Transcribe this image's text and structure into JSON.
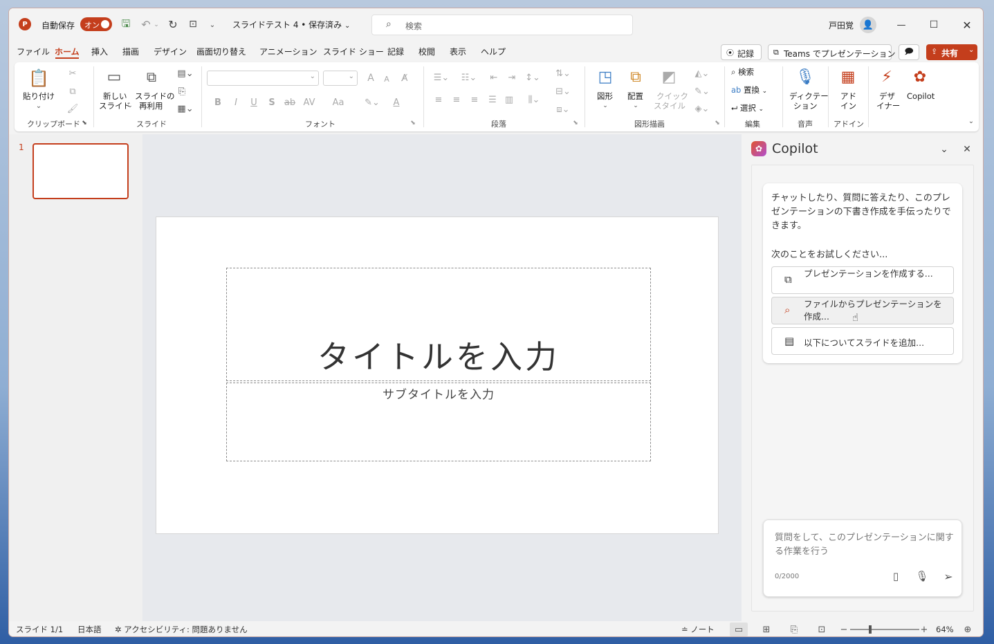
{
  "titlebar": {
    "autosave_label": "自動保存",
    "autosave_toggle": "オン",
    "doc_title": "スライドテスト 4 • 保存済み",
    "search_placeholder": "検索",
    "user_name": "戸田覚"
  },
  "menu": {
    "items": [
      "ファイル",
      "ホーム",
      "挿入",
      "描画",
      "デザイン",
      "画面切り替え",
      "アニメーション",
      "スライド ショー",
      "記録",
      "校閲",
      "表示",
      "ヘルプ"
    ],
    "record_btn": "記録",
    "teams_btn": "Teams でプレゼンテーション",
    "share_btn": "共有"
  },
  "ribbon": {
    "clipboard": {
      "paste": "貼り付け",
      "label": "クリップボード"
    },
    "slides": {
      "new_slide_1": "新しい",
      "new_slide_2": "スライド",
      "reuse_1": "スライドの",
      "reuse_2": "再利用",
      "label": "スライド"
    },
    "font": {
      "label": "フォント",
      "bold": "B",
      "italic": "I",
      "underline": "U",
      "strike": "S",
      "strikethrough": "ab",
      "spacing": "AV",
      "case": "Aa",
      "grow": "A",
      "shrink": "A",
      "color": "A"
    },
    "paragraph": {
      "label": "段落"
    },
    "drawing": {
      "shapes": "図形",
      "arrange": "配置",
      "quick_1": "クイック",
      "quick_2": "スタイル",
      "label": "図形描画"
    },
    "editing": {
      "find": "検索",
      "replace": "置換",
      "select": "選択",
      "label": "編集"
    },
    "voice": {
      "dictate_1": "ディクテー",
      "dictate_2": "ション",
      "label": "音声"
    },
    "addins": {
      "addin_1": "アド",
      "addin_2": "イン",
      "label": "アドイン"
    },
    "designer": {
      "d1": "デザ",
      "d2": "イナー"
    },
    "copilot_btn": "Copilot"
  },
  "thumbnail": {
    "number": "1"
  },
  "slide": {
    "title": "タイトルを入力",
    "subtitle": "サブタイトルを入力"
  },
  "copilot": {
    "title": "Copilot",
    "intro": "チャットしたり、質問に答えたり、このプレゼンテーションの下書き作成を手伝ったりできます。",
    "try_label": "次のことをお試しください...",
    "suggestions": [
      "プレゼンテーションを作成する...",
      "ファイルからプレゼンテーションを作成...",
      "以下についてスライドを追加..."
    ],
    "input_placeholder": "質問をして、このプレゼンテーションに関する作業を行う",
    "char_count": "0/2000"
  },
  "status": {
    "slide_count": "スライド 1/1",
    "language": "日本語",
    "accessibility": "アクセシビリティ: 問題ありません",
    "notes": "ノート",
    "zoom": "64%"
  },
  "colors": {
    "accent": "#c43e1c",
    "share": "#c43e1c"
  }
}
